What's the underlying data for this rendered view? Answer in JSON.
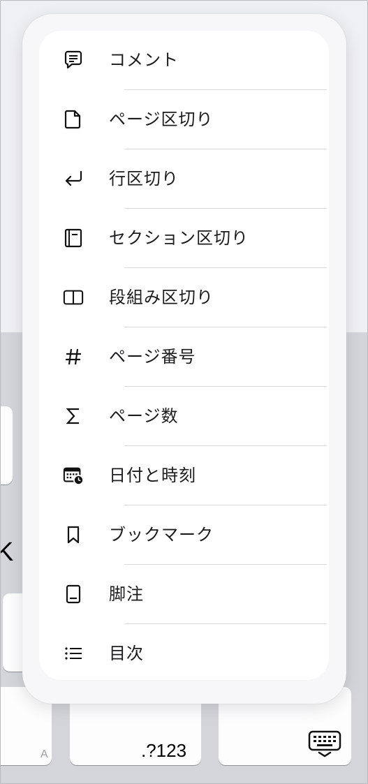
{
  "menu": {
    "items": [
      {
        "name": "comment",
        "label": "コメント",
        "icon": "comment-icon"
      },
      {
        "name": "page-break",
        "label": "ページ区切り",
        "icon": "page-icon"
      },
      {
        "name": "line-break",
        "label": "行区切り",
        "icon": "return-arrow-icon"
      },
      {
        "name": "section-break",
        "label": "セクション区切り",
        "icon": "section-icon"
      },
      {
        "name": "column-break",
        "label": "段組み区切り",
        "icon": "columns-icon"
      },
      {
        "name": "page-number",
        "label": "ページ番号",
        "icon": "hash-icon"
      },
      {
        "name": "page-count",
        "label": "ページ数",
        "icon": "sigma-icon"
      },
      {
        "name": "date-time",
        "label": "日付と時刻",
        "icon": "calendar-clock-icon"
      },
      {
        "name": "bookmark",
        "label": "ブックマーク",
        "icon": "bookmark-icon"
      },
      {
        "name": "footnote",
        "label": "脚注",
        "icon": "footnote-icon"
      },
      {
        "name": "toc",
        "label": "目次",
        "icon": "list-icon"
      }
    ]
  },
  "keyboard": {
    "numbers_key": ".?123",
    "small_a": "A",
    "partial_letter": "K",
    "dismiss_icon": "keyboard-dismiss-icon"
  },
  "colors": {
    "popup_bg": "#ffffff",
    "popup_border": "#f7f7f9",
    "keyboard_bg": "#d3d5da",
    "text": "#1c1c1e"
  }
}
